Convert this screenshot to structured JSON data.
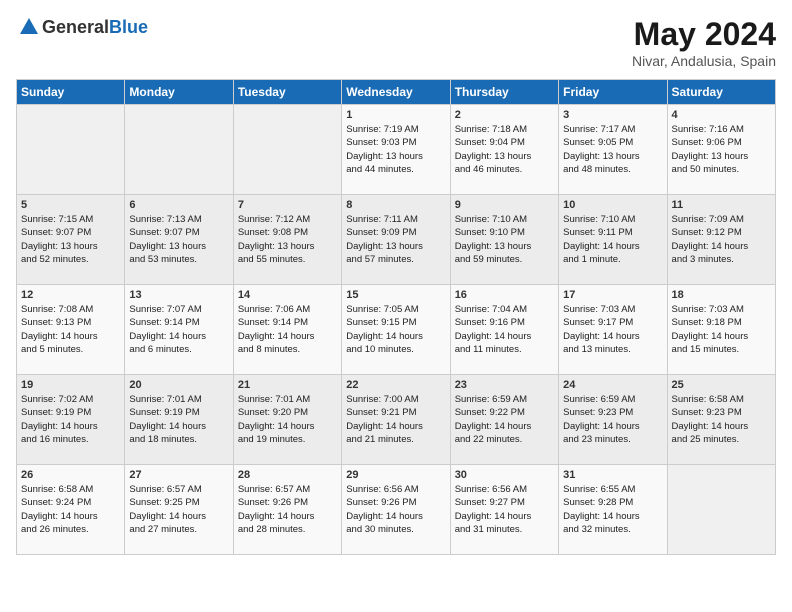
{
  "header": {
    "logo_general": "General",
    "logo_blue": "Blue",
    "month": "May 2024",
    "location": "Nivar, Andalusia, Spain"
  },
  "weekdays": [
    "Sunday",
    "Monday",
    "Tuesday",
    "Wednesday",
    "Thursday",
    "Friday",
    "Saturday"
  ],
  "weeks": [
    [
      {
        "day": "",
        "content": ""
      },
      {
        "day": "",
        "content": ""
      },
      {
        "day": "",
        "content": ""
      },
      {
        "day": "1",
        "content": "Sunrise: 7:19 AM\nSunset: 9:03 PM\nDaylight: 13 hours\nand 44 minutes."
      },
      {
        "day": "2",
        "content": "Sunrise: 7:18 AM\nSunset: 9:04 PM\nDaylight: 13 hours\nand 46 minutes."
      },
      {
        "day": "3",
        "content": "Sunrise: 7:17 AM\nSunset: 9:05 PM\nDaylight: 13 hours\nand 48 minutes."
      },
      {
        "day": "4",
        "content": "Sunrise: 7:16 AM\nSunset: 9:06 PM\nDaylight: 13 hours\nand 50 minutes."
      }
    ],
    [
      {
        "day": "5",
        "content": "Sunrise: 7:15 AM\nSunset: 9:07 PM\nDaylight: 13 hours\nand 52 minutes."
      },
      {
        "day": "6",
        "content": "Sunrise: 7:13 AM\nSunset: 9:07 PM\nDaylight: 13 hours\nand 53 minutes."
      },
      {
        "day": "7",
        "content": "Sunrise: 7:12 AM\nSunset: 9:08 PM\nDaylight: 13 hours\nand 55 minutes."
      },
      {
        "day": "8",
        "content": "Sunrise: 7:11 AM\nSunset: 9:09 PM\nDaylight: 13 hours\nand 57 minutes."
      },
      {
        "day": "9",
        "content": "Sunrise: 7:10 AM\nSunset: 9:10 PM\nDaylight: 13 hours\nand 59 minutes."
      },
      {
        "day": "10",
        "content": "Sunrise: 7:10 AM\nSunset: 9:11 PM\nDaylight: 14 hours\nand 1 minute."
      },
      {
        "day": "11",
        "content": "Sunrise: 7:09 AM\nSunset: 9:12 PM\nDaylight: 14 hours\nand 3 minutes."
      }
    ],
    [
      {
        "day": "12",
        "content": "Sunrise: 7:08 AM\nSunset: 9:13 PM\nDaylight: 14 hours\nand 5 minutes."
      },
      {
        "day": "13",
        "content": "Sunrise: 7:07 AM\nSunset: 9:14 PM\nDaylight: 14 hours\nand 6 minutes."
      },
      {
        "day": "14",
        "content": "Sunrise: 7:06 AM\nSunset: 9:14 PM\nDaylight: 14 hours\nand 8 minutes."
      },
      {
        "day": "15",
        "content": "Sunrise: 7:05 AM\nSunset: 9:15 PM\nDaylight: 14 hours\nand 10 minutes."
      },
      {
        "day": "16",
        "content": "Sunrise: 7:04 AM\nSunset: 9:16 PM\nDaylight: 14 hours\nand 11 minutes."
      },
      {
        "day": "17",
        "content": "Sunrise: 7:03 AM\nSunset: 9:17 PM\nDaylight: 14 hours\nand 13 minutes."
      },
      {
        "day": "18",
        "content": "Sunrise: 7:03 AM\nSunset: 9:18 PM\nDaylight: 14 hours\nand 15 minutes."
      }
    ],
    [
      {
        "day": "19",
        "content": "Sunrise: 7:02 AM\nSunset: 9:19 PM\nDaylight: 14 hours\nand 16 minutes."
      },
      {
        "day": "20",
        "content": "Sunrise: 7:01 AM\nSunset: 9:19 PM\nDaylight: 14 hours\nand 18 minutes."
      },
      {
        "day": "21",
        "content": "Sunrise: 7:01 AM\nSunset: 9:20 PM\nDaylight: 14 hours\nand 19 minutes."
      },
      {
        "day": "22",
        "content": "Sunrise: 7:00 AM\nSunset: 9:21 PM\nDaylight: 14 hours\nand 21 minutes."
      },
      {
        "day": "23",
        "content": "Sunrise: 6:59 AM\nSunset: 9:22 PM\nDaylight: 14 hours\nand 22 minutes."
      },
      {
        "day": "24",
        "content": "Sunrise: 6:59 AM\nSunset: 9:23 PM\nDaylight: 14 hours\nand 23 minutes."
      },
      {
        "day": "25",
        "content": "Sunrise: 6:58 AM\nSunset: 9:23 PM\nDaylight: 14 hours\nand 25 minutes."
      }
    ],
    [
      {
        "day": "26",
        "content": "Sunrise: 6:58 AM\nSunset: 9:24 PM\nDaylight: 14 hours\nand 26 minutes."
      },
      {
        "day": "27",
        "content": "Sunrise: 6:57 AM\nSunset: 9:25 PM\nDaylight: 14 hours\nand 27 minutes."
      },
      {
        "day": "28",
        "content": "Sunrise: 6:57 AM\nSunset: 9:26 PM\nDaylight: 14 hours\nand 28 minutes."
      },
      {
        "day": "29",
        "content": "Sunrise: 6:56 AM\nSunset: 9:26 PM\nDaylight: 14 hours\nand 30 minutes."
      },
      {
        "day": "30",
        "content": "Sunrise: 6:56 AM\nSunset: 9:27 PM\nDaylight: 14 hours\nand 31 minutes."
      },
      {
        "day": "31",
        "content": "Sunrise: 6:55 AM\nSunset: 9:28 PM\nDaylight: 14 hours\nand 32 minutes."
      },
      {
        "day": "",
        "content": ""
      }
    ]
  ]
}
